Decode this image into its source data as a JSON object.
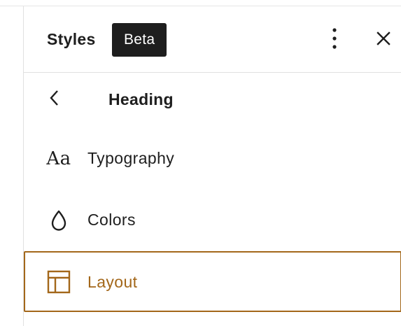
{
  "header": {
    "title": "Styles",
    "badge": "Beta"
  },
  "nav": {
    "section_title": "Heading"
  },
  "menu": {
    "items": [
      {
        "label": "Typography",
        "icon": "typography-icon",
        "icon_glyph": "Aa"
      },
      {
        "label": "Colors",
        "icon": "droplet-icon"
      },
      {
        "label": "Layout",
        "icon": "layout-icon",
        "selected": true
      }
    ]
  },
  "colors": {
    "accent": "#a3671a",
    "text": "#1e1e1e",
    "badge_bg": "#1e1e1e",
    "divider": "#e0e0e0"
  }
}
